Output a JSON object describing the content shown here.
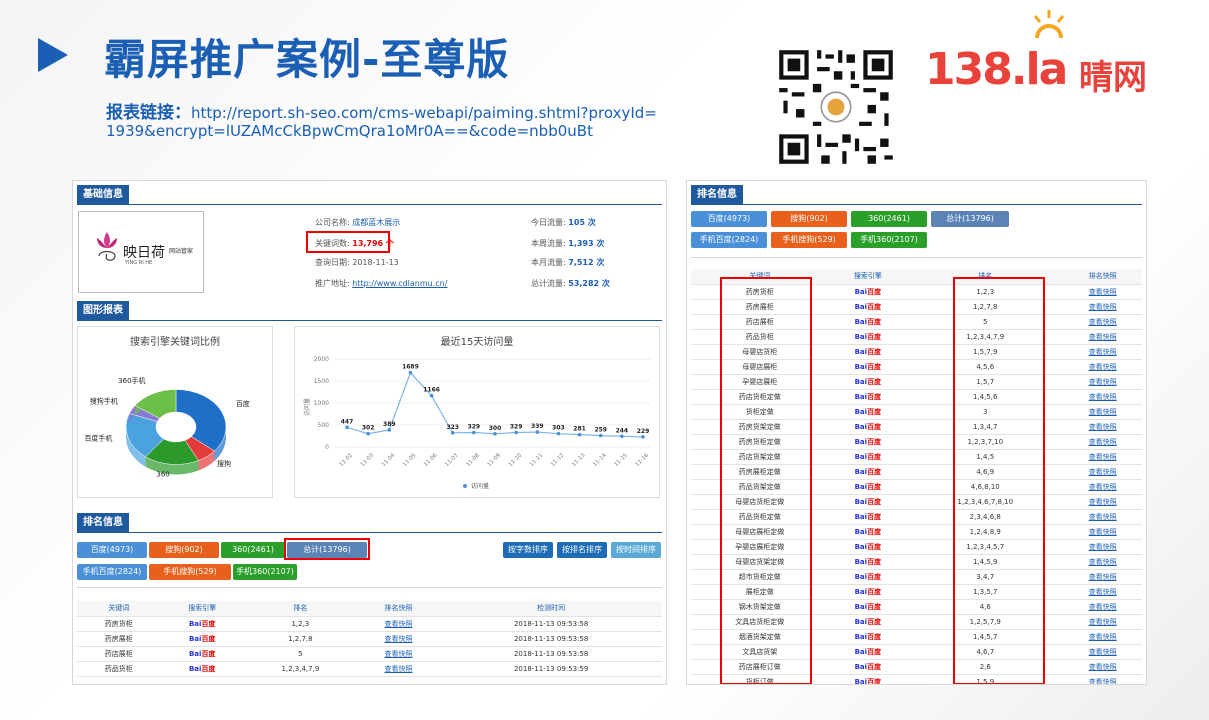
{
  "slide": {
    "title": "霸屏推广案例-至尊版",
    "report_label": "报表链接：",
    "report_url": "http://report.sh-seo.com/cms-webapi/paiming.shtml?proxyId=1939&encrypt=lUZAMcCkBpwCmQra1oMr0A==&code=nbb0uBt",
    "logo_number": "138.la",
    "logo_cn": "晴网",
    "accent_color": "#1a5fb4",
    "logo_color": "#e8423a"
  },
  "basic_info": {
    "section_title": "基础信息",
    "logo_text": "映日荷",
    "logo_sub": "网站管家",
    "logo_pinyin": "YING RI HE",
    "company_label": "公司名称:",
    "company_value": "成都蓝木展示",
    "keywords_label": "关键词数:",
    "keywords_value": "13,796 个",
    "query_date_label": "查询日期:",
    "query_date_value": "2018-11-13",
    "promo_label": "推广地址:",
    "promo_value": "http://www.cdlanmu.cn/",
    "today_label": "今日流量:",
    "today_value": "105 次",
    "week_label": "本周流量:",
    "week_value": "1,393 次",
    "month_label": "本月流量:",
    "month_value": "7,512 次",
    "total_label": "总计流量:",
    "total_value": "53,282 次"
  },
  "graph_section": {
    "section_title": "图形报表",
    "pie_title": "搜索引擎关键词比例",
    "line_title": "最近15天访问量",
    "line_legend": "访问量",
    "line_ylabel": "访问量"
  },
  "chart_data": [
    {
      "type": "pie",
      "title": "搜索引擎关键词比例",
      "categories": [
        "百度",
        "搜狗",
        "360",
        "百度手机",
        "搜狗手机",
        "360手机"
      ],
      "values": [
        4973,
        902,
        2461,
        2824,
        529,
        2107
      ]
    },
    {
      "type": "line",
      "title": "最近15天访问量",
      "x": [
        "11-02",
        "11-03",
        "11-04",
        "11-05",
        "11-06",
        "11-07",
        "11-08",
        "11-09",
        "11-10",
        "11-11",
        "11-12",
        "11-13",
        "11-14",
        "11-15",
        "11-16"
      ],
      "series": [
        {
          "name": "访问量",
          "values": [
            447,
            302,
            389,
            1689,
            1166,
            323,
            329,
            300,
            329,
            339,
            303,
            281,
            259,
            244,
            229
          ]
        }
      ],
      "ylim": [
        0,
        2000
      ],
      "yticks": [
        "0",
        "500",
        "1000",
        "1500",
        "2000"
      ]
    }
  ],
  "ranking_left": {
    "section_title": "排名信息",
    "tabs_row1": [
      "百度(4973)",
      "搜狗(902)",
      "360(2461)",
      "总计(13796)"
    ],
    "tabs_row2": [
      "手机百度(2824)",
      "手机搜狗(529)",
      "手机360(2107)"
    ],
    "sort_buttons": [
      "按字数排序",
      "按排名排序",
      "按时间排序"
    ],
    "columns": [
      "关键词",
      "搜索引擎",
      "排名",
      "排名快照",
      "检测时间"
    ],
    "rows": [
      {
        "kw": "药房货柜",
        "rank": "1,2,3",
        "snap": "查看快照",
        "time": "2018-11-13 09:53:58"
      },
      {
        "kw": "药房展柜",
        "rank": "1,2,7,8",
        "snap": "查看快照",
        "time": "2018-11-13 09:53:58"
      },
      {
        "kw": "药店展柜",
        "rank": "5",
        "snap": "查看快照",
        "time": "2018-11-13 09:53:58"
      },
      {
        "kw": "药品货柜",
        "rank": "1,2,3,4,7,9",
        "snap": "查看快照",
        "time": "2018-11-13 09:53:59"
      }
    ]
  },
  "ranking_right": {
    "section_title": "排名信息",
    "tabs_row1": [
      "百度(4973)",
      "搜狗(902)",
      "360(2461)",
      "总计(13796)"
    ],
    "tabs_row2": [
      "手机百度(2824)",
      "手机搜狗(529)",
      "手机360(2107)"
    ],
    "columns": [
      "关键词",
      "搜索引擎",
      "排名",
      "排名快照"
    ],
    "baidu_a": "Bai",
    "baidu_b": "百度",
    "snap_label": "查看快照",
    "rows": [
      {
        "kw": "药房货柜",
        "rank": "1,2,3"
      },
      {
        "kw": "药房展柜",
        "rank": "1,2,7,8"
      },
      {
        "kw": "药店展柜",
        "rank": "5"
      },
      {
        "kw": "药品货柜",
        "rank": "1,2,3,4,7,9"
      },
      {
        "kw": "母婴店货柜",
        "rank": "1,5,7,9"
      },
      {
        "kw": "母婴店展柜",
        "rank": "4,5,6"
      },
      {
        "kw": "孕婴店展柜",
        "rank": "1,5,7"
      },
      {
        "kw": "药店货柜定做",
        "rank": "1,4,5,6"
      },
      {
        "kw": "货柜定做",
        "rank": "3"
      },
      {
        "kw": "药房货架定做",
        "rank": "1,3,4,7"
      },
      {
        "kw": "药房货柜定做",
        "rank": "1,2,3,7,10"
      },
      {
        "kw": "药店货架定做",
        "rank": "1,4,5"
      },
      {
        "kw": "药房展柜定做",
        "rank": "4,6,9"
      },
      {
        "kw": "药品货架定做",
        "rank": "4,6,8,10"
      },
      {
        "kw": "母婴店货柜定做",
        "rank": "1,2,3,4,6,7,8,10"
      },
      {
        "kw": "药品货柜定做",
        "rank": "2,3,4,6,8"
      },
      {
        "kw": "母婴店展柜定做",
        "rank": "1,2,4,8,9"
      },
      {
        "kw": "孕婴店展柜定做",
        "rank": "1,2,3,4,5,7"
      },
      {
        "kw": "母婴店货架定做",
        "rank": "1,4,5,9"
      },
      {
        "kw": "超市货柜定做",
        "rank": "3,4,7"
      },
      {
        "kw": "展柜定做",
        "rank": "1,3,5,7"
      },
      {
        "kw": "钢木货架定做",
        "rank": "4,6"
      },
      {
        "kw": "文具店货柜定做",
        "rank": "1,2,5,7,9"
      },
      {
        "kw": "烟酒货架定做",
        "rank": "1,4,5,7"
      },
      {
        "kw": "文具店货架",
        "rank": "4,6,7"
      },
      {
        "kw": "药店展柜订做",
        "rank": "2,6"
      },
      {
        "kw": "货柜订做",
        "rank": "1,5,9"
      }
    ]
  }
}
